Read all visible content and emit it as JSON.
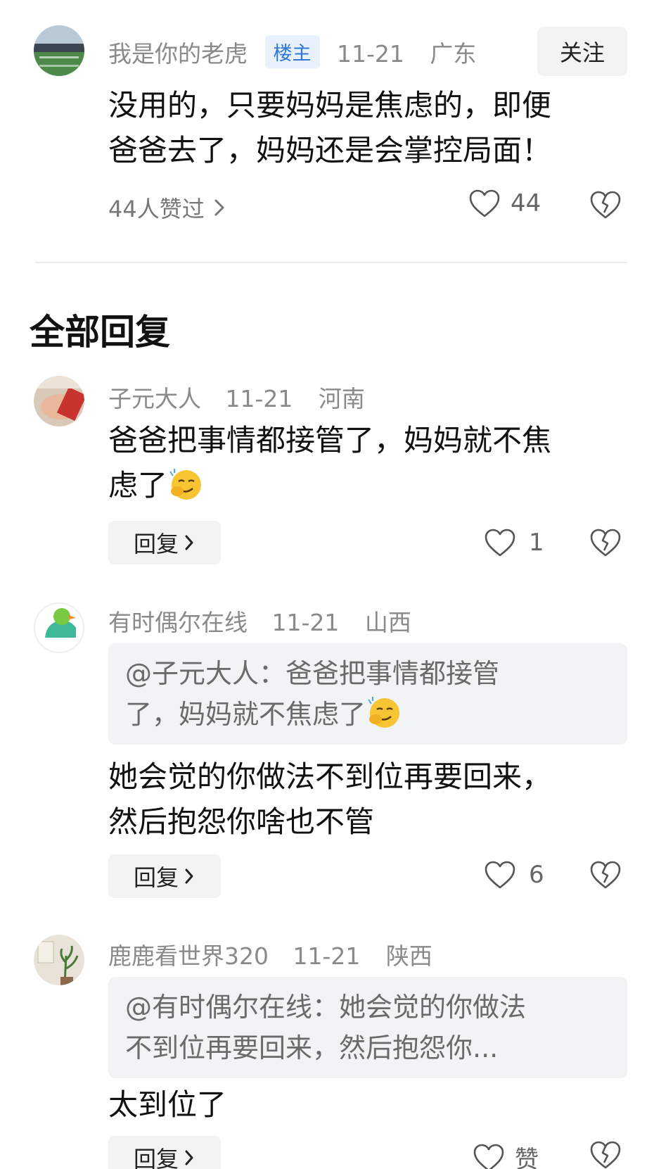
{
  "main_comment": {
    "username": "我是你的老虎",
    "badge": "楼主",
    "date": "11-21",
    "location": "广东",
    "follow_label": "关注",
    "text_line1": "没用的，只要妈妈是焦虑的，即便",
    "text_line2": "爸爸去了，妈妈还是会掌控局面！",
    "liked_by": "44人赞过",
    "like_count": "44"
  },
  "section_title": "全部回复",
  "replies": [
    {
      "username": "子元大人",
      "date": "11-21",
      "location": "河南",
      "text_line1": "爸爸把事情都接管了，妈妈就不焦",
      "text_line2": "虑了",
      "reply_label": "回复",
      "like_count": "1"
    },
    {
      "username": "有时偶尔在线",
      "date": "11-21",
      "location": "山西",
      "quote_line1": "@子元大人：爸爸把事情都接管",
      "quote_line2": "了，妈妈就不焦虑了",
      "text_line1": "她会觉的你做法不到位再要回来，",
      "text_line2": "然后抱怨你啥也不管",
      "reply_label": "回复",
      "like_count": "6"
    },
    {
      "username": "鹿鹿看世界320",
      "date": "11-21",
      "location": "陕西",
      "quote_line1": "@有时偶尔在线：她会觉的你做法",
      "quote_line2": "不到位再要回来，然后抱怨你...",
      "text_line1": "太到位了",
      "reply_label": "回复",
      "like_label": "赞"
    }
  ],
  "icons": {
    "like": "heart-outline-icon",
    "dislike": "broken-heart-icon",
    "chevron": "chevron-right-icon",
    "emoji": "smirk-emoji-icon"
  },
  "colors": {
    "badge_bg": "#e8f1fc",
    "badge_text": "#2f78d6",
    "meta_text": "#8a8a8a",
    "button_bg": "#f3f3f3",
    "quote_bg": "#f2f3f5"
  }
}
